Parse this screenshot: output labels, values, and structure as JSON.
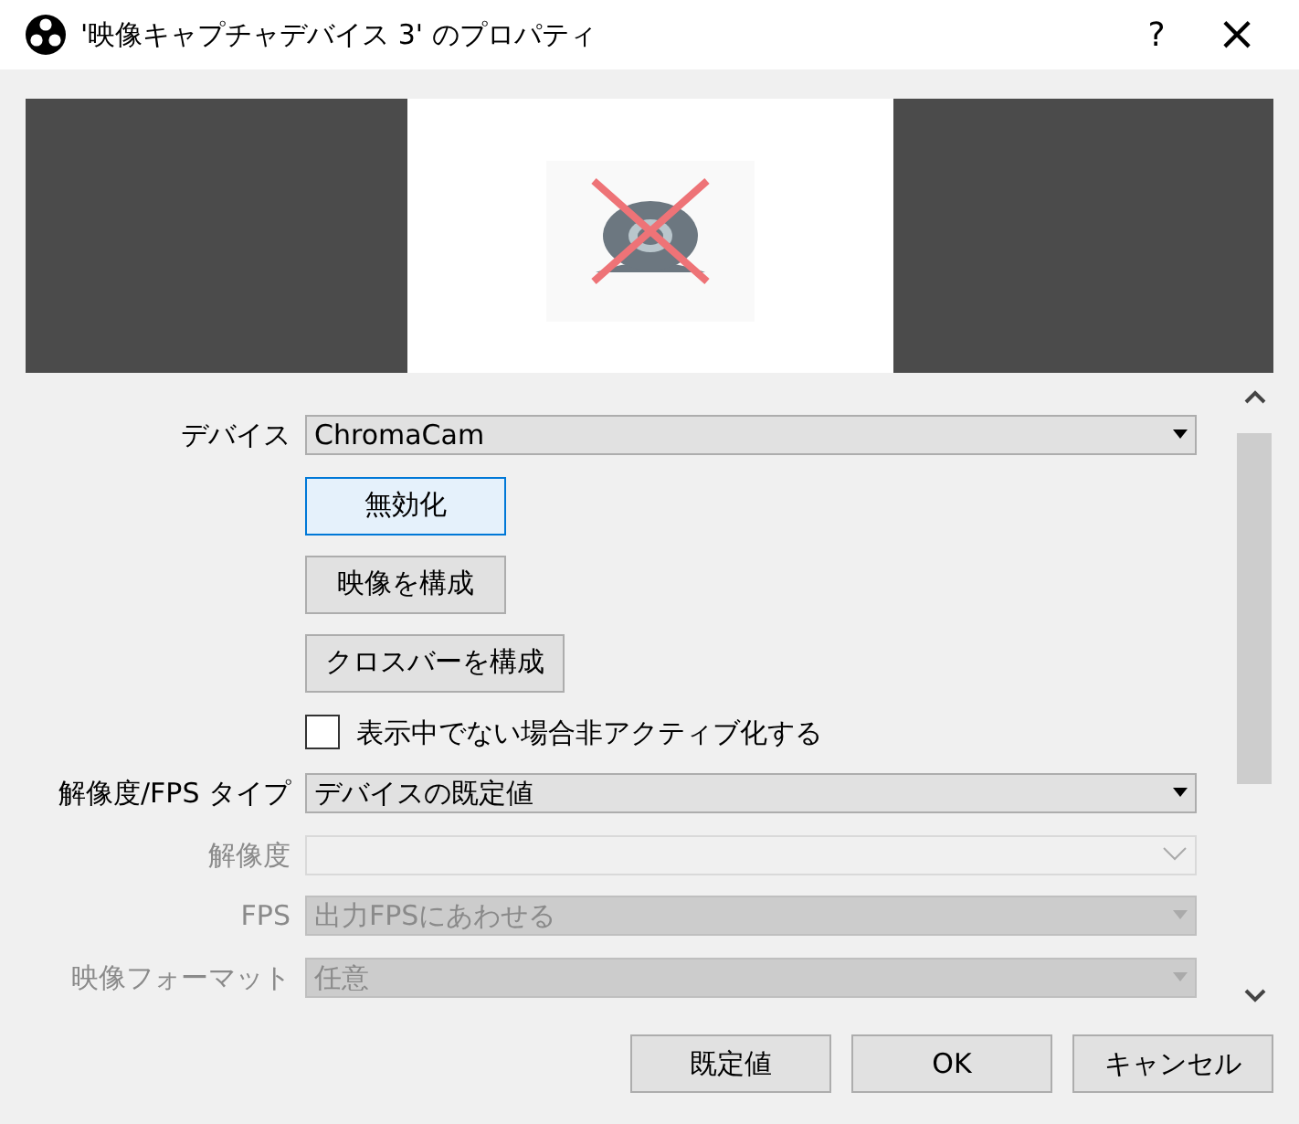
{
  "window": {
    "title": "'映像キャプチャデバイス 3' のプロパティ",
    "help": "?",
    "close": "×"
  },
  "fields": [
    {
      "kind": "select",
      "label": "デバイス",
      "value": "ChromaCam",
      "disabled": false
    },
    {
      "kind": "button",
      "text": "無効化",
      "focused": true
    },
    {
      "kind": "button",
      "text": "映像を構成",
      "focused": false
    },
    {
      "kind": "button",
      "text": "クロスバーを構成",
      "focused": false
    },
    {
      "kind": "checkbox",
      "text": "表示中でない場合非アクティブ化する",
      "checked": false
    },
    {
      "kind": "select",
      "label": "解像度/FPS タイプ",
      "value": "デバイスの既定値",
      "disabled": false
    },
    {
      "kind": "combo",
      "label": "解像度",
      "disabled": true
    },
    {
      "kind": "select",
      "label": "FPS",
      "value": "出力FPSにあわせる",
      "disabled": true
    },
    {
      "kind": "select",
      "label": "映像フォーマット",
      "value": "任意",
      "disabled": true
    }
  ],
  "buttons": [
    "既定値",
    "OK",
    "キャンセル"
  ]
}
